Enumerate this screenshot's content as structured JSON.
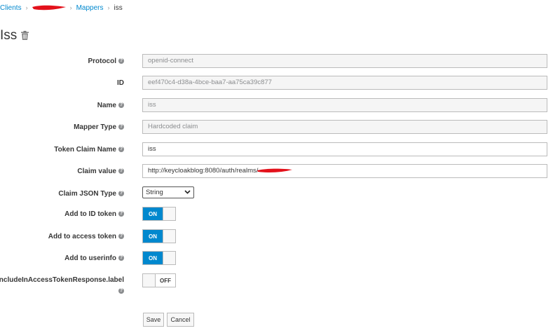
{
  "breadcrumb": {
    "clients": "Clients",
    "mappers": "Mappers",
    "current": "iss"
  },
  "page": {
    "title": "Iss"
  },
  "form": {
    "protocol": {
      "label": "Protocol",
      "value": "openid-connect"
    },
    "id": {
      "label": "ID",
      "value": "eef470c4-d38a-4bce-baa7-aa75ca39c877"
    },
    "name": {
      "label": "Name",
      "value": "iss"
    },
    "mapper_type": {
      "label": "Mapper Type",
      "value": "Hardcoded claim"
    },
    "token_claim_name": {
      "label": "Token Claim Name",
      "value": "iss"
    },
    "claim_value": {
      "label": "Claim value",
      "value": "http://keycloakblog:8080/auth/realms/"
    },
    "claim_json_type": {
      "label": "Claim JSON Type",
      "value": "String"
    },
    "add_to_id_token": {
      "label": "Add to ID token",
      "state": "ON"
    },
    "add_to_access_token": {
      "label": "Add to access token",
      "state": "ON"
    },
    "add_to_userinfo": {
      "label": "Add to userinfo",
      "state": "ON"
    },
    "include_in_access_token_response": {
      "label_line1": "includeInAccessTokenResponse.label",
      "state": "OFF"
    }
  },
  "actions": {
    "save": "Save",
    "cancel": "Cancel"
  },
  "colors": {
    "accent": "#0088ce",
    "redaction": "#e3111b"
  }
}
